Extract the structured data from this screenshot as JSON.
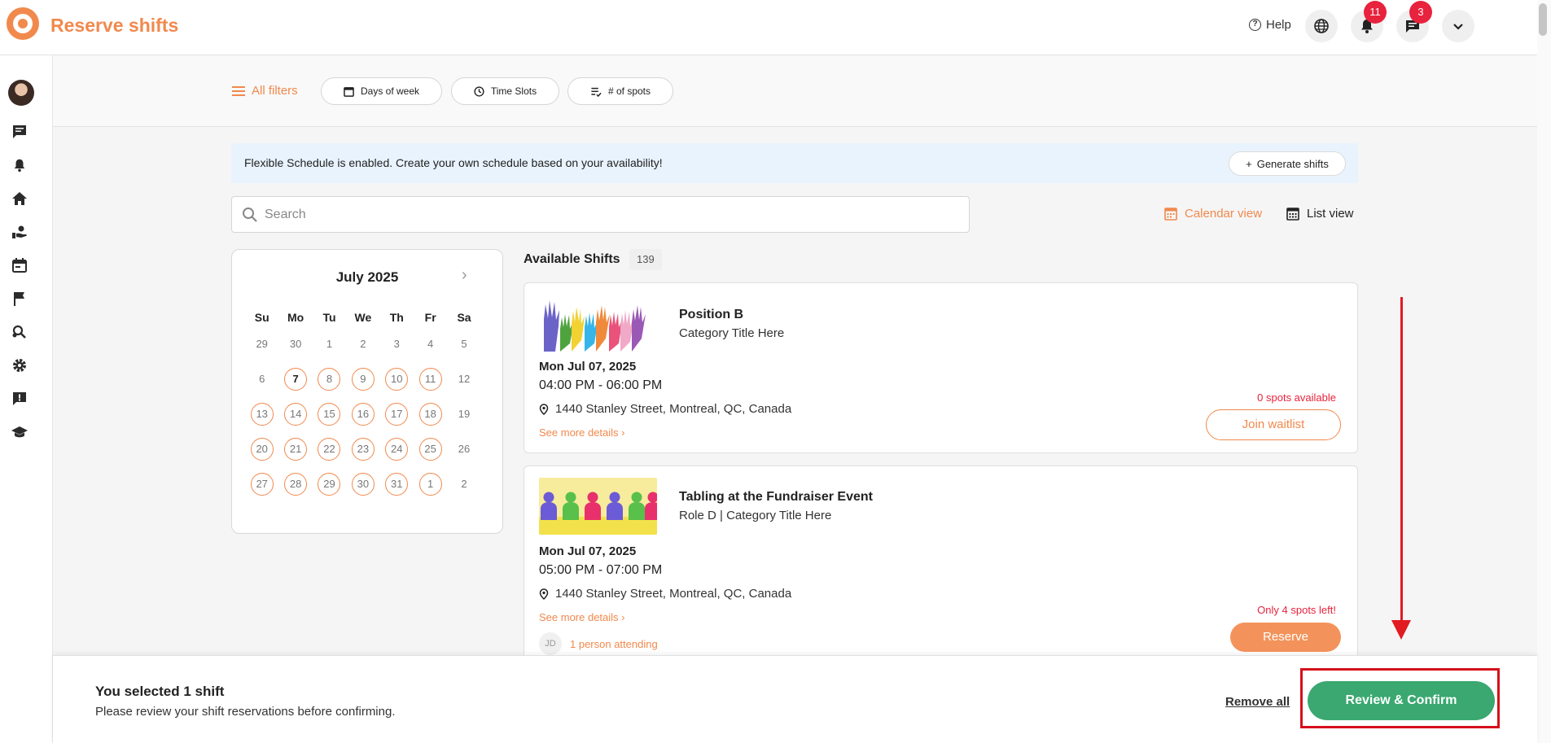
{
  "header": {
    "title": "Reserve shifts",
    "help_label": "Help",
    "notifications_count": "11",
    "messages_count": "3"
  },
  "filters": {
    "all_filters": "All filters",
    "days_of_week": "Days of week",
    "time_slots": "Time Slots",
    "num_spots": "# of spots"
  },
  "banner": {
    "text": "Flexible Schedule is enabled. Create your own schedule based on your availability!",
    "generate_label": "Generate shifts"
  },
  "search": {
    "placeholder": "Search"
  },
  "views": {
    "calendar": "Calendar view",
    "list": "List view"
  },
  "calendar": {
    "month_label": "July 2025",
    "weekdays": [
      "Su",
      "Mo",
      "Tu",
      "We",
      "Th",
      "Fr",
      "Sa"
    ],
    "weeks": [
      [
        {
          "d": "29",
          "a": false
        },
        {
          "d": "30",
          "a": false
        },
        {
          "d": "1",
          "a": false
        },
        {
          "d": "2",
          "a": false
        },
        {
          "d": "3",
          "a": false
        },
        {
          "d": "4",
          "a": false
        },
        {
          "d": "5",
          "a": false
        }
      ],
      [
        {
          "d": "6",
          "a": false
        },
        {
          "d": "7",
          "a": true,
          "today": true
        },
        {
          "d": "8",
          "a": true
        },
        {
          "d": "9",
          "a": true
        },
        {
          "d": "10",
          "a": true
        },
        {
          "d": "11",
          "a": true
        },
        {
          "d": "12",
          "a": false
        }
      ],
      [
        {
          "d": "13",
          "a": true
        },
        {
          "d": "14",
          "a": true
        },
        {
          "d": "15",
          "a": true
        },
        {
          "d": "16",
          "a": true
        },
        {
          "d": "17",
          "a": true
        },
        {
          "d": "18",
          "a": true
        },
        {
          "d": "19",
          "a": false
        }
      ],
      [
        {
          "d": "20",
          "a": true
        },
        {
          "d": "21",
          "a": true
        },
        {
          "d": "22",
          "a": true
        },
        {
          "d": "23",
          "a": true
        },
        {
          "d": "24",
          "a": true
        },
        {
          "d": "25",
          "a": true
        },
        {
          "d": "26",
          "a": false
        }
      ],
      [
        {
          "d": "27",
          "a": true
        },
        {
          "d": "28",
          "a": true
        },
        {
          "d": "29",
          "a": true
        },
        {
          "d": "30",
          "a": true
        },
        {
          "d": "31",
          "a": true
        },
        {
          "d": "1",
          "a": true
        },
        {
          "d": "2",
          "a": false
        }
      ]
    ]
  },
  "shifts": {
    "title": "Available Shifts",
    "count": "139",
    "items": [
      {
        "title": "Position B",
        "subtitle": "Category Title Here",
        "date": "Mon Jul 07, 2025",
        "time": "04:00 PM - 06:00 PM",
        "location": "1440 Stanley Street, Montreal, QC, Canada",
        "more": "See more details",
        "spots": "0 spots available",
        "action": "Join waitlist"
      },
      {
        "title": "Tabling at the Fundraiser Event",
        "subtitle": "Role D | Category Title Here",
        "date": "Mon Jul 07, 2025",
        "time": "05:00 PM - 07:00 PM",
        "location": "1440 Stanley Street, Montreal, QC, Canada",
        "more": "See more details",
        "spots": "Only 4 spots left!",
        "action": "Reserve",
        "attendee_initials": "JD",
        "attending": "1 person attending"
      }
    ]
  },
  "selection": {
    "title": "You selected 1 shift",
    "subtitle": "Please review your shift reservations before confirming.",
    "remove_all": "Remove all",
    "confirm": "Review & Confirm"
  },
  "colors": {
    "accent": "#f1894d",
    "confirm": "#3aa870",
    "alert": "#e8233d",
    "annotation": "#d6101c"
  }
}
